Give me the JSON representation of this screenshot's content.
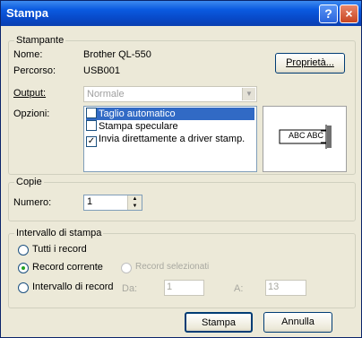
{
  "window": {
    "title": "Stampa",
    "help_glyph": "?",
    "close_glyph": "×"
  },
  "printer": {
    "legend": "Stampante",
    "name_label": "Nome:",
    "name_value": "Brother QL-550",
    "path_label": "Percorso:",
    "path_value": "USB001",
    "properties_button": "Proprietà...",
    "output_label": "Output:",
    "output_value": "Normale",
    "options_label": "Opzioni:",
    "options": [
      {
        "label": "Taglio automatico",
        "checked": false,
        "selected": true
      },
      {
        "label": "Stampa speculare",
        "checked": false,
        "selected": false
      },
      {
        "label": "Invia direttamente a driver stamp.",
        "checked": true,
        "selected": false
      }
    ],
    "preview_text": "ABC ABC"
  },
  "copies": {
    "legend": "Copie",
    "number_label": "Numero:",
    "number_value": "1"
  },
  "range": {
    "legend": "Intervallo di stampa",
    "all_records": "Tutti i record",
    "current_record": "Record corrente",
    "selected_records": "Record selezionati",
    "record_range": "Intervallo di record",
    "from_label": "Da:",
    "from_value": "1",
    "to_label": "A:",
    "to_value": "13",
    "selected_option": "current_record"
  },
  "buttons": {
    "print": "Stampa",
    "cancel": "Annulla"
  },
  "colors": {
    "titlebar": "#0a5ae0",
    "dialog_bg": "#ece9d8",
    "selection": "#316ac5"
  }
}
